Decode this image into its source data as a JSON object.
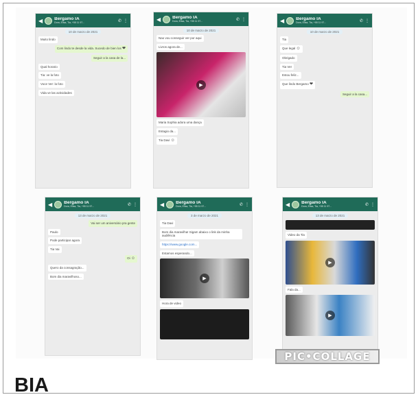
{
  "header": {
    "group_name": "Bergamo IA",
    "participants": "Dora, Elisa, Tia, +55 11 97...",
    "icons": [
      "back-arrow-icon",
      "call-icon",
      "menu-icon"
    ]
  },
  "screens": [
    {
      "date": "10 de marzo de 2021",
      "messages": [
        {
          "dir": "in",
          "text": "Muito lindo"
        },
        {
          "dir": "out",
          "text": "Com lindo te desde la vida. Sucedo de bien los"
        },
        {
          "dir": "out",
          "text": "Seguir a la casa de la..."
        },
        {
          "dir": "in",
          "text": "Qual horario"
        },
        {
          "dir": "in",
          "text": "Tia: ve la foto"
        },
        {
          "dir": "in",
          "text": "Voce Ver: la foto"
        },
        {
          "dir": "in",
          "text": "Vida ve las actividades"
        }
      ]
    },
    {
      "date": "10 de marzo de 2021",
      "messages": [
        {
          "dir": "in",
          "text": "Nao vou conseguir ver por aqui"
        },
        {
          "dir": "in",
          "text": "Livros agora de..."
        },
        {
          "dir": "in",
          "text": "Maria Sophia adora uma dança"
        },
        {
          "dir": "in",
          "text": "Estagio da..."
        },
        {
          "dir": "in",
          "text": "Tia Davi"
        }
      ]
    },
    {
      "date": "10 de marzo de 2021",
      "messages": [
        {
          "dir": "in",
          "text": "Tia"
        },
        {
          "dir": "in",
          "text": "Que legal"
        },
        {
          "dir": "in",
          "text": "Obrigado"
        },
        {
          "dir": "in",
          "text": "Tia Ver"
        },
        {
          "dir": "in",
          "text": "Estou feliz..."
        },
        {
          "dir": "in",
          "text": "Que lindo Bergamo"
        },
        {
          "dir": "out",
          "text": "Seguir a la casa..."
        }
      ]
    },
    {
      "date": "13 de marzo de 2021",
      "messages": [
        {
          "dir": "out",
          "text": "Vai ser um aniversário pra gente"
        },
        {
          "dir": "in",
          "text": "Paulo"
        },
        {
          "dir": "in",
          "text": "Pode participar agora"
        },
        {
          "dir": "in",
          "text": "Tia Vai"
        },
        {
          "dir": "out",
          "text": "Oi"
        },
        {
          "dir": "in",
          "text": "Quero da consagração..."
        },
        {
          "dir": "in",
          "text": "Bom dia maravilhoso..."
        }
      ]
    },
    {
      "date": "3 de marzo de 2021",
      "messages": [
        {
          "dir": "in",
          "text": "Tia Davi"
        },
        {
          "dir": "in",
          "text": "Bom dia maravilha! Sigam abaixo o link da minha audiência"
        },
        {
          "dir": "in",
          "text": "https://www.google.com..."
        },
        {
          "dir": "in",
          "text": "Estamos esperando..."
        },
        {
          "dir": "in",
          "text": "Hora de video"
        }
      ]
    },
    {
      "date": "13 de marzo de 2021",
      "messages": [
        {
          "dir": "in",
          "text": "Video da Tia"
        },
        {
          "dir": "in",
          "text": "Fala da..."
        },
        {
          "dir": "in",
          "text": "Tia da video"
        }
      ]
    }
  ],
  "watermark": "PIC•COLLAGE",
  "label": "BIA",
  "colors": {
    "header": "#1f6b58",
    "bubble_out": "#e5f7cf"
  }
}
